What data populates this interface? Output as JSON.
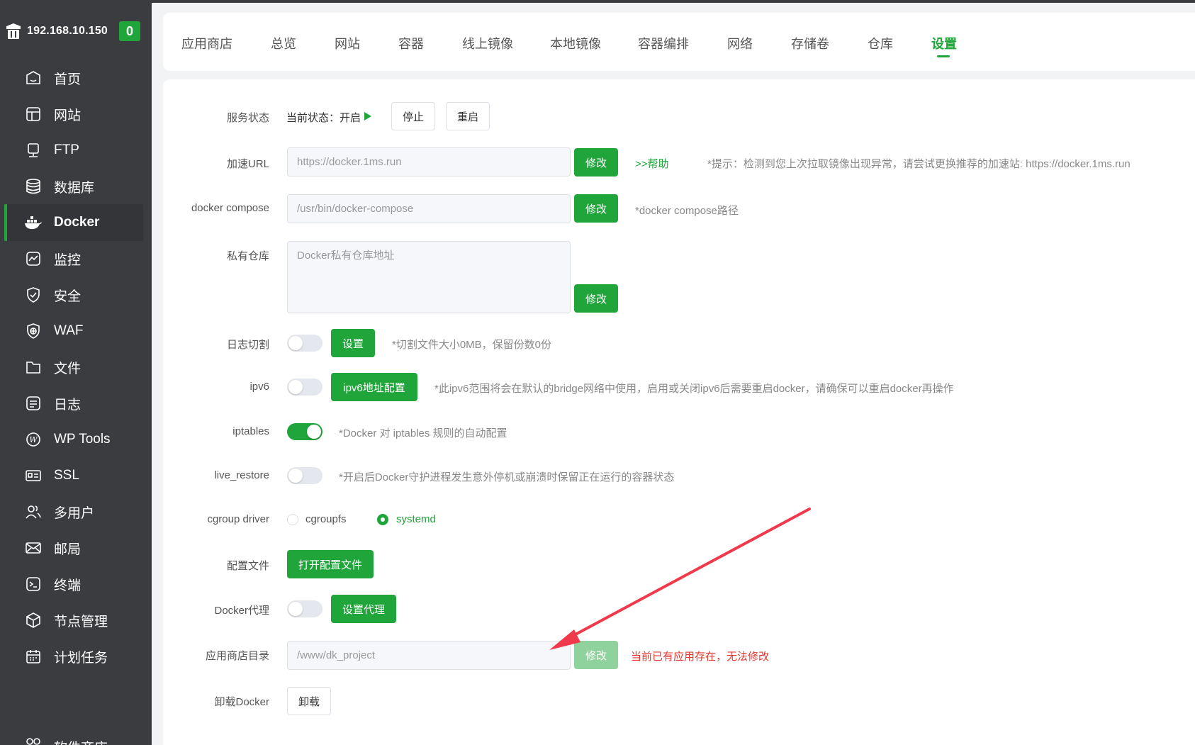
{
  "sidebar": {
    "ip": "192.168.10.150",
    "badge": "0",
    "items": [
      {
        "label": "首页"
      },
      {
        "label": "网站"
      },
      {
        "label": "FTP"
      },
      {
        "label": "数据库"
      },
      {
        "label": "Docker"
      },
      {
        "label": "监控"
      },
      {
        "label": "安全"
      },
      {
        "label": "WAF"
      },
      {
        "label": "文件"
      },
      {
        "label": "日志"
      },
      {
        "label": "WP Tools"
      },
      {
        "label": "SSL"
      },
      {
        "label": "多用户"
      },
      {
        "label": "邮局"
      },
      {
        "label": "终端"
      },
      {
        "label": "节点管理"
      },
      {
        "label": "计划任务"
      },
      {
        "label": "软件商店"
      }
    ],
    "active": "Docker"
  },
  "tabs": [
    "应用商店",
    "总览",
    "网站",
    "容器",
    "线上镜像",
    "本地镜像",
    "容器编排",
    "网络",
    "存储卷",
    "仓库",
    "设置"
  ],
  "active_tab": "设置",
  "settings": {
    "service": {
      "label": "服务状态",
      "status": "当前状态：开启",
      "stop": "停止",
      "restart": "重启"
    },
    "accel": {
      "label": "加速URL",
      "value": "https://docker.1ms.run",
      "btn": "修改",
      "help": ">>帮助",
      "tip": "*提示：检测到您上次拉取镜像出现异常，请尝试更换推荐的加速站: https://docker.1ms.run"
    },
    "compose": {
      "label": "docker compose",
      "value": "/usr/bin/docker-compose",
      "btn": "修改",
      "tip": "*docker compose路径"
    },
    "registry": {
      "label": "私有仓库",
      "placeholder": "Docker私有仓库地址",
      "btn": "修改"
    },
    "logcut": {
      "label": "日志切割",
      "on": false,
      "btn": "设置",
      "tip": "*切割文件大小0MB，保留份数0份"
    },
    "ipv6": {
      "label": "ipv6",
      "on": false,
      "btn": "ipv6地址配置",
      "tip": "*此ipv6范围将会在默认的bridge网络中使用，启用或关闭ipv6后需要重启docker，请确保可以重启docker再操作"
    },
    "iptables": {
      "label": "iptables",
      "on": true,
      "tip": "*Docker 对 iptables 规则的自动配置"
    },
    "live_restore": {
      "label": "live_restore",
      "on": false,
      "tip": "*开启后Docker守护进程发生意外停机或崩溃时保留正在运行的容器状态"
    },
    "cgroup": {
      "label": "cgroup driver",
      "options": [
        "cgroupfs",
        "systemd"
      ],
      "selected": "systemd"
    },
    "config": {
      "label": "配置文件",
      "btn": "打开配置文件"
    },
    "proxy": {
      "label": "Docker代理",
      "on": false,
      "btn": "设置代理"
    },
    "appdir": {
      "label": "应用商店目录",
      "value": "/www/dk_project",
      "btn": "修改",
      "error": "当前已有应用存在，无法修改"
    },
    "uninstall": {
      "label": "卸载Docker",
      "btn": "卸载"
    }
  },
  "colors": {
    "accent": "#20a53a",
    "sidebar": "#3b3c3f",
    "error": "#e6372e",
    "arrow": "#f0394a"
  }
}
